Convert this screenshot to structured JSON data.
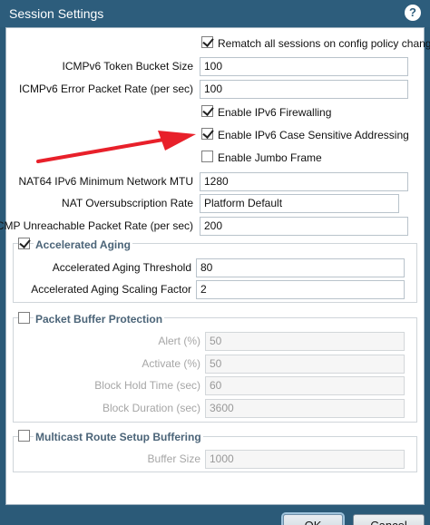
{
  "dialog": {
    "title": "Session Settings",
    "help_glyph": "?"
  },
  "fields": {
    "rematch": {
      "label": "Rematch all sessions on config policy change",
      "checked": true
    },
    "icmpv6_token": {
      "label": "ICMPv6 Token Bucket Size",
      "value": "100"
    },
    "icmpv6_error": {
      "label": "ICMPv6 Error Packet Rate (per sec)",
      "value": "100"
    },
    "ipv6_firewalling": {
      "label": "Enable IPv6 Firewalling",
      "checked": true
    },
    "ipv6_case": {
      "label": "Enable IPv6 Case Sensitive Addressing",
      "checked": true
    },
    "jumbo": {
      "label": "Enable Jumbo Frame",
      "checked": false
    },
    "nat64_mtu": {
      "label": "NAT64 IPv6 Minimum Network MTU",
      "value": "1280"
    },
    "nat_oversub": {
      "label": "NAT Oversubscription Rate",
      "value": "Platform Default"
    },
    "icmp_unreach": {
      "label": "ICMP Unreachable Packet Rate (per sec)",
      "value": "200"
    }
  },
  "accelerated_aging": {
    "title": "Accelerated Aging",
    "checked": true,
    "threshold": {
      "label": "Accelerated Aging Threshold",
      "value": "80"
    },
    "scaling": {
      "label": "Accelerated Aging Scaling Factor",
      "value": "2"
    }
  },
  "packet_buffer": {
    "title": "Packet Buffer Protection",
    "checked": false,
    "alert": {
      "label": "Alert (%)",
      "value": "50"
    },
    "activate": {
      "label": "Activate (%)",
      "value": "50"
    },
    "hold_time": {
      "label": "Block Hold Time (sec)",
      "value": "60"
    },
    "duration": {
      "label": "Block Duration (sec)",
      "value": "3600"
    }
  },
  "multicast": {
    "title": "Multicast Route Setup Buffering",
    "checked": false,
    "buffer_size": {
      "label": "Buffer Size",
      "value": "1000"
    }
  },
  "buttons": {
    "ok": "OK",
    "cancel": "Cancel"
  },
  "colors": {
    "titlebar": "#2d5d7c",
    "arrow": "#e8202a",
    "group_title": "#4b6478"
  }
}
